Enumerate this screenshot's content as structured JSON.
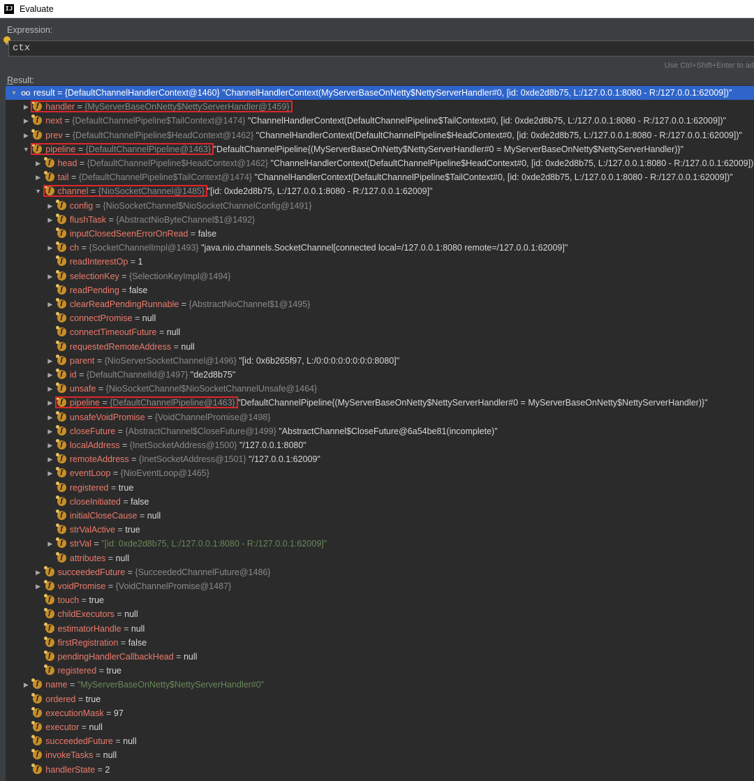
{
  "window": {
    "title": "Evaluate"
  },
  "expression": {
    "label": "Expression:",
    "value": "ctx",
    "hint": "Use Ctrl+Shift+Enter to ad"
  },
  "result": {
    "label_underlined": "R",
    "label_rest": "esult:"
  },
  "rows": [
    {
      "level": 0,
      "arrow": "down",
      "icon": "oo",
      "name": "result",
      "ref": "{DefaultChannelHandlerContext@1460}",
      "str": "\"ChannelHandlerContext(MyServerBaseOnNetty$NettyServerHandler#0, [id: 0xde2d8b75, L:/127.0.0.1:8080 - R:/127.0.0.1:62009])\"",
      "selected": true
    },
    {
      "level": 1,
      "arrow": "right",
      "icon": "f",
      "name": "handler",
      "ref": "{MyServerBaseOnNetty$NettyServerHandler@1459}",
      "hl": true
    },
    {
      "level": 1,
      "arrow": "right",
      "icon": "f",
      "name": "next",
      "ref": "{DefaultChannelPipeline$TailContext@1474}",
      "str": "\"ChannelHandlerContext(DefaultChannelPipeline$TailContext#0, [id: 0xde2d8b75, L:/127.0.0.1:8080 - R:/127.0.0.1:62009])\""
    },
    {
      "level": 1,
      "arrow": "right",
      "icon": "f",
      "name": "prev",
      "ref": "{DefaultChannelPipeline$HeadContext@1462}",
      "str": "\"ChannelHandlerContext(DefaultChannelPipeline$HeadContext#0, [id: 0xde2d8b75, L:/127.0.0.1:8080 - R:/127.0.0.1:62009])\""
    },
    {
      "level": 1,
      "arrow": "down",
      "icon": "f",
      "name": "pipeline",
      "ref": "{DefaultChannelPipeline@1463}",
      "str": "\"DefaultChannelPipeline{(MyServerBaseOnNetty$NettyServerHandler#0 = MyServerBaseOnNetty$NettyServerHandler)}\"",
      "hl": true
    },
    {
      "level": 2,
      "arrow": "right",
      "icon": "f",
      "name": "head",
      "ref": "{DefaultChannelPipeline$HeadContext@1462}",
      "str": "\"ChannelHandlerContext(DefaultChannelPipeline$HeadContext#0, [id: 0xde2d8b75, L:/127.0.0.1:8080 - R:/127.0.0.1:62009])\""
    },
    {
      "level": 2,
      "arrow": "right",
      "icon": "f",
      "name": "tail",
      "ref": "{DefaultChannelPipeline$TailContext@1474}",
      "str": "\"ChannelHandlerContext(DefaultChannelPipeline$TailContext#0, [id: 0xde2d8b75, L:/127.0.0.1:8080 - R:/127.0.0.1:62009])\""
    },
    {
      "level": 2,
      "arrow": "down",
      "icon": "f",
      "name": "channel",
      "ref": "{NioSocketChannel@1485}",
      "str": "\"[id: 0xde2d8b75, L:/127.0.0.1:8080 - R:/127.0.0.1:62009]\"",
      "hl": true
    },
    {
      "level": 3,
      "arrow": "right",
      "icon": "f",
      "name": "config",
      "ref": "{NioSocketChannel$NioSocketChannelConfig@1491}"
    },
    {
      "level": 3,
      "arrow": "right",
      "icon": "f",
      "name": "flushTask",
      "ref": "{AbstractNioByteChannel$1@1492}"
    },
    {
      "level": 3,
      "arrow": "none",
      "icon": "f",
      "name": "inputClosedSeenErrorOnRead",
      "val": "false"
    },
    {
      "level": 3,
      "arrow": "right",
      "icon": "f",
      "name": "ch",
      "ref": "{SocketChannelImpl@1493}",
      "str": "\"java.nio.channels.SocketChannel[connected local=/127.0.0.1:8080 remote=/127.0.0.1:62009]\""
    },
    {
      "level": 3,
      "arrow": "none",
      "icon": "f",
      "name": "readInterestOp",
      "val": "1"
    },
    {
      "level": 3,
      "arrow": "right",
      "icon": "f",
      "name": "selectionKey",
      "ref": "{SelectionKeyImpl@1494}"
    },
    {
      "level": 3,
      "arrow": "none",
      "icon": "f",
      "name": "readPending",
      "val": "false"
    },
    {
      "level": 3,
      "arrow": "right",
      "icon": "f",
      "name": "clearReadPendingRunnable",
      "ref": "{AbstractNioChannel$1@1495}"
    },
    {
      "level": 3,
      "arrow": "none",
      "icon": "f",
      "name": "connectPromise",
      "val": "null"
    },
    {
      "level": 3,
      "arrow": "none",
      "icon": "f",
      "name": "connectTimeoutFuture",
      "val": "null"
    },
    {
      "level": 3,
      "arrow": "none",
      "icon": "f",
      "name": "requestedRemoteAddress",
      "val": "null"
    },
    {
      "level": 3,
      "arrow": "right",
      "icon": "f",
      "name": "parent",
      "ref": "{NioServerSocketChannel@1496}",
      "str": "\"[id: 0x6b265f97, L:/0:0:0:0:0:0:0:0:8080]\""
    },
    {
      "level": 3,
      "arrow": "right",
      "icon": "f",
      "name": "id",
      "ref": "{DefaultChannelId@1497}",
      "str": "\"de2d8b75\""
    },
    {
      "level": 3,
      "arrow": "right",
      "icon": "f",
      "name": "unsafe",
      "ref": "{NioSocketChannel$NioSocketChannelUnsafe@1464}"
    },
    {
      "level": 3,
      "arrow": "right",
      "icon": "f",
      "name": "pipeline",
      "ref": "{DefaultChannelPipeline@1463}",
      "str": "\"DefaultChannelPipeline{(MyServerBaseOnNetty$NettyServerHandler#0 = MyServerBaseOnNetty$NettyServerHandler)}\"",
      "hl": true
    },
    {
      "level": 3,
      "arrow": "right",
      "icon": "f",
      "name": "unsafeVoidPromise",
      "ref": "{VoidChannelPromise@1498}"
    },
    {
      "level": 3,
      "arrow": "right",
      "icon": "f",
      "name": "closeFuture",
      "ref": "{AbstractChannel$CloseFuture@1499}",
      "str": "\"AbstractChannel$CloseFuture@6a54be81(incomplete)\""
    },
    {
      "level": 3,
      "arrow": "right",
      "icon": "f",
      "name": "localAddress",
      "ref": "{InetSocketAddress@1500}",
      "str": "\"/127.0.0.1:8080\""
    },
    {
      "level": 3,
      "arrow": "right",
      "icon": "f",
      "name": "remoteAddress",
      "ref": "{InetSocketAddress@1501}",
      "str": "\"/127.0.0.1:62009\""
    },
    {
      "level": 3,
      "arrow": "right",
      "icon": "f",
      "name": "eventLoop",
      "ref": "{NioEventLoop@1465}"
    },
    {
      "level": 3,
      "arrow": "none",
      "icon": "f",
      "name": "registered",
      "val": "true"
    },
    {
      "level": 3,
      "arrow": "none",
      "icon": "f",
      "name": "closeInitiated",
      "val": "false"
    },
    {
      "level": 3,
      "arrow": "none",
      "icon": "f",
      "name": "initialCloseCause",
      "val": "null"
    },
    {
      "level": 3,
      "arrow": "none",
      "icon": "f",
      "name": "strValActive",
      "val": "true"
    },
    {
      "level": 3,
      "arrow": "right",
      "icon": "f",
      "name": "strVal",
      "gstr": "\"[id: 0xde2d8b75, L:/127.0.0.1:8080 - R:/127.0.0.1:62009]\""
    },
    {
      "level": 3,
      "arrow": "none",
      "icon": "f",
      "name": "attributes",
      "val": "null"
    },
    {
      "level": 2,
      "arrow": "right",
      "icon": "f",
      "name": "succeededFuture",
      "ref": "{SucceededChannelFuture@1486}"
    },
    {
      "level": 2,
      "arrow": "right",
      "icon": "f",
      "name": "voidPromise",
      "ref": "{VoidChannelPromise@1487}"
    },
    {
      "level": 2,
      "arrow": "none",
      "icon": "f",
      "name": "touch",
      "val": "true"
    },
    {
      "level": 2,
      "arrow": "none",
      "icon": "f",
      "name": "childExecutors",
      "val": "null"
    },
    {
      "level": 2,
      "arrow": "none",
      "icon": "f",
      "name": "estimatorHandle",
      "val": "null"
    },
    {
      "level": 2,
      "arrow": "none",
      "icon": "f",
      "name": "firstRegistration",
      "val": "false"
    },
    {
      "level": 2,
      "arrow": "none",
      "icon": "f",
      "name": "pendingHandlerCallbackHead",
      "val": "null"
    },
    {
      "level": 2,
      "arrow": "none",
      "icon": "f",
      "name": "registered",
      "val": "true"
    },
    {
      "level": 1,
      "arrow": "right",
      "icon": "f",
      "name": "name",
      "gstr": "\"MyServerBaseOnNetty$NettyServerHandler#0\""
    },
    {
      "level": 1,
      "arrow": "none",
      "icon": "f",
      "name": "ordered",
      "val": "true"
    },
    {
      "level": 1,
      "arrow": "none",
      "icon": "f",
      "name": "executionMask",
      "val": "97"
    },
    {
      "level": 1,
      "arrow": "none",
      "icon": "f",
      "name": "executor",
      "val": "null"
    },
    {
      "level": 1,
      "arrow": "none",
      "icon": "f",
      "name": "succeededFuture",
      "val": "null"
    },
    {
      "level": 1,
      "arrow": "none",
      "icon": "f",
      "name": "invokeTasks",
      "val": "null"
    },
    {
      "level": 1,
      "arrow": "none",
      "icon": "f",
      "name": "handlerState",
      "val": "2"
    }
  ]
}
